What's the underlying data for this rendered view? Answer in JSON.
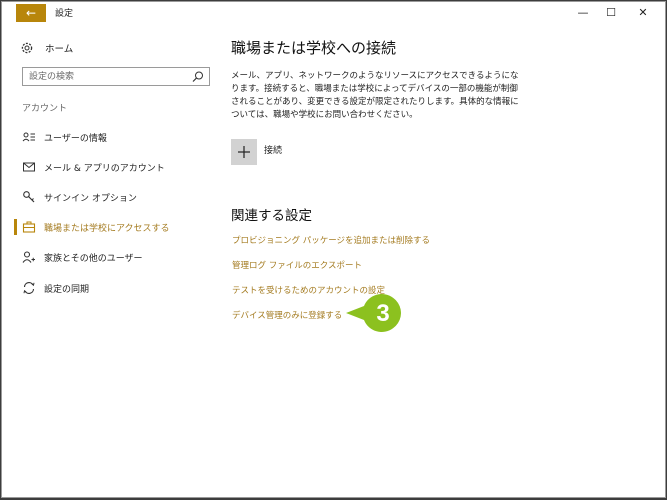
{
  "window": {
    "title": "設定",
    "back_glyph": "←",
    "controls": {
      "minimize": "—",
      "maximize": "☐",
      "close": "✕"
    }
  },
  "sidebar": {
    "home_label": "ホーム",
    "search_placeholder": "設定の検索",
    "section_label": "アカウント",
    "items": [
      {
        "label": "ユーザーの情報",
        "icon": "user-info-icon",
        "active": false
      },
      {
        "label": "メール & アプリのアカウント",
        "icon": "mail-icon",
        "active": false
      },
      {
        "label": "サインイン オプション",
        "icon": "key-icon",
        "active": false
      },
      {
        "label": "職場または学校にアクセスする",
        "icon": "briefcase-icon",
        "active": true
      },
      {
        "label": "家族とその他のユーザー",
        "icon": "add-person-icon",
        "active": false
      },
      {
        "label": "設定の同期",
        "icon": "sync-icon",
        "active": false
      }
    ]
  },
  "main": {
    "title": "職場または学校への接続",
    "description": "メール、アプリ、ネットワークのようなリソースにアクセスできるようになります。接続すると、職場または学校によってデバイスの一部の機能が制御されることがあり、変更できる設定が限定されたりします。具体的な情報については、職場や学校にお問い合わせください。",
    "connect_label": "接続",
    "related_title": "関連する設定",
    "related_links": [
      "プロビジョニング パッケージを追加または削除する",
      "管理ログ ファイルのエクスポート",
      "テストを受けるためのアカウントの設定",
      "デバイス管理のみに登録する"
    ]
  },
  "callout": {
    "number": "3",
    "color": "#8cc11f"
  },
  "colors": {
    "accent": "#b8860b",
    "link": "#a47b20",
    "background": "#3d3d3d"
  }
}
